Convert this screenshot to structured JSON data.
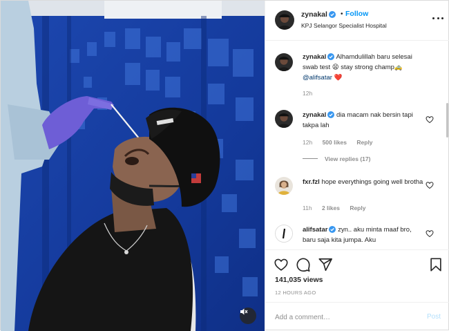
{
  "header": {
    "username": "zynakal",
    "dot": "•",
    "follow_label": "Follow",
    "location": "KPJ Selangor Specialist Hospital"
  },
  "comments": [
    {
      "username": "zynakal",
      "text": "Alhamdulillah baru selesai swab test 😫 stay strong champ🚕",
      "mention": "@alifsatar",
      "emoji_end": "❤️",
      "time": "12h"
    },
    {
      "username": "zynakal",
      "text": "dia macam nak bersin tapi takpa lah",
      "time": "12h",
      "likes": "500 likes",
      "reply_label": "Reply",
      "view_replies": "View replies (17)"
    },
    {
      "username": "fxr.fzl",
      "text": "hope everythings going well brotha",
      "time": "11h",
      "likes": "2 likes",
      "reply_label": "Reply"
    },
    {
      "username": "alifsatar",
      "text": "zyn.. aku minta maaf bro, baru saja kita jumpa. Aku"
    }
  ],
  "stats": {
    "views": "141,035 views",
    "time_ago": "12 HOURS AGO"
  },
  "add_comment": {
    "placeholder": "Add a comment…",
    "post_label": "Post"
  },
  "icons": {
    "verified": "verified-badge-icon",
    "like": "heart-icon",
    "comment": "comment-icon",
    "share": "paper-plane-icon",
    "save": "bookmark-icon",
    "more": "more-options-icon",
    "mute": "speaker-muted-icon"
  },
  "colors": {
    "accent": "#0095f6",
    "verified": "#3897f0",
    "muted_text": "#8e8e8e",
    "mention": "#00376b",
    "post_disabled": "#b2dffc"
  }
}
